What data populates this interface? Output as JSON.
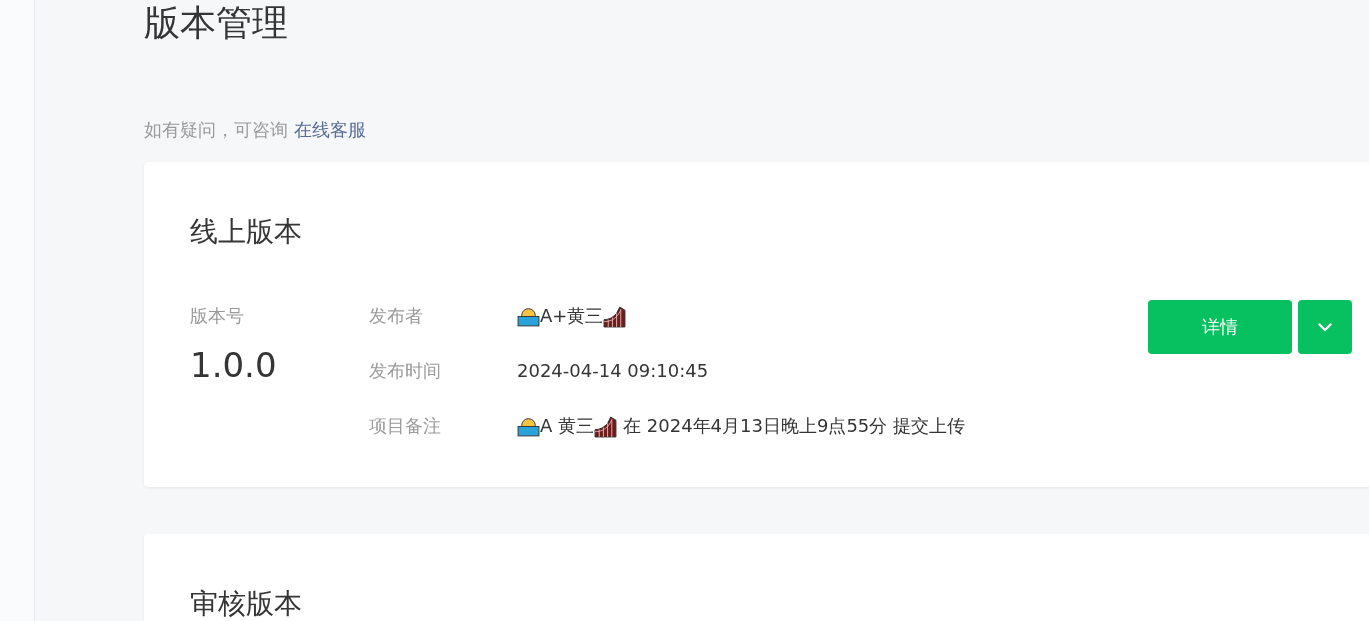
{
  "page": {
    "title": "版本管理",
    "help": {
      "text": "如有疑问，可咨询",
      "link": "在线客服"
    }
  },
  "online_version": {
    "title": "线上版本",
    "version_label": "版本号",
    "version": "1.0.0",
    "rows": [
      {
        "label": "发布者",
        "kind": "person",
        "name": "A+黄三"
      },
      {
        "label": "发布时间",
        "kind": "text",
        "value": "2024-04-14 09:10:45"
      },
      {
        "label": "项目备注",
        "kind": "person",
        "name": "A 黄三",
        "suffix": "在 2024年4月13日晚上9点55分 提交上传"
      }
    ],
    "buttons": [
      {
        "kind": "text",
        "label": "详情"
      },
      {
        "kind": "menu"
      }
    ]
  },
  "review_version": {
    "title": "审核版本"
  }
}
